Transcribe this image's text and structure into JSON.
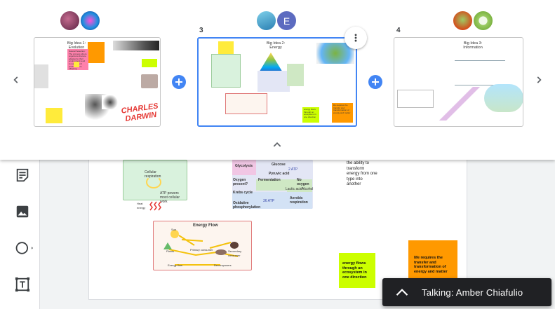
{
  "left_toolbar": {
    "items": [
      {
        "name": "sticky-note-tool",
        "icon": "sticky-note-icon"
      },
      {
        "name": "image-tool",
        "icon": "image-icon"
      },
      {
        "name": "shape-tool",
        "icon": "circle-icon"
      },
      {
        "name": "text-box-tool",
        "icon": "text-box-icon"
      }
    ]
  },
  "board": {
    "cellular_respiration_labels": {
      "glycolysis": "Glycolysis",
      "glucose": "Glucose",
      "pyruvic_acid": "Pyruvic acid",
      "oxygen_present": "Oxygen present?",
      "fermentation": "Fermentation",
      "no_oxygen": "No oxygen",
      "krebs": "Krebs cycle",
      "lactic_acid": "Lactic acid",
      "alcohol": "Alcohol",
      "oxidative": "Oxidative phosphorylation",
      "atp_36": "36 ATP",
      "aerobic": "Aerobic respiration",
      "atp_2": "2 ATP"
    },
    "photosynthesis_labels": {
      "cellular_respiration": "Cellular respiration",
      "atp": "ATP powers most cellular work",
      "heat": "Heat energy"
    },
    "energy_flow": {
      "title": "Energy Flow",
      "sun": "Sun",
      "plants": "Plants",
      "primary": "Primary consumer",
      "secondary": "Secondary consumer",
      "energy_flow": "Energy flow",
      "decomposers": "Decomposers"
    },
    "text_block": "the ability to transform energy from one type into another",
    "sticky_green": "energy flows through an ecosystem in one direction",
    "sticky_orange": "life requires the transfer and transformation of energy and matter"
  },
  "strip": {
    "frames": [
      {
        "number": "",
        "title": "Big Idea 1: Evolution",
        "pink_note": "Natural Selection: The process where organisms that are adapted to their environment tend to survive and produce more offspring",
        "orange_note": "",
        "yellow_note": "",
        "green_note": "",
        "logo": "CHARLES DARWIN"
      },
      {
        "number": "3",
        "title": "Big Idea 2: Energy",
        "pink_note": "",
        "orange_note": "life requires the transfer and transformation of energy and matter",
        "yellow_note": "",
        "green_note": "energy flows through an ecosystem in one direction",
        "logo": ""
      },
      {
        "number": "4",
        "title": "Big Idea 3: Information",
        "pink_note": "",
        "orange_note": "",
        "yellow_note": "",
        "green_note": "",
        "logo": ""
      }
    ],
    "avatars": [
      {
        "letter": "",
        "color": "#8e3a59"
      },
      {
        "letter": "",
        "color": "#2e7bcf"
      },
      {
        "letter": "",
        "color": "#4fa3c7"
      },
      {
        "letter": "E",
        "color": "#5c6bc0"
      },
      {
        "letter": "",
        "color": "#d4493e"
      },
      {
        "letter": "",
        "color": "#8bc34a"
      }
    ]
  },
  "talking": {
    "text": "Talking: Amber Chiafulio"
  },
  "colors": {
    "accent": "#4285f4",
    "sticky_yellow": "#ffeb3b",
    "sticky_green": "#ccff00",
    "sticky_orange": "#ff9900",
    "sticky_pink": "#ff80ab",
    "toast": "#202124"
  }
}
